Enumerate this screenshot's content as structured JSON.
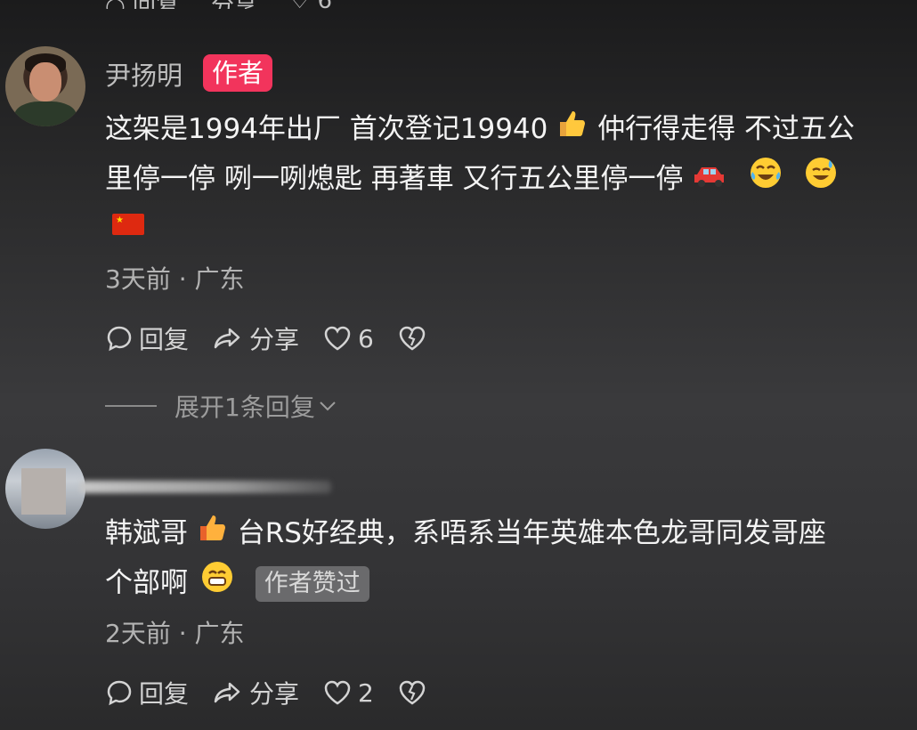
{
  "comments": [
    {
      "username": "尹扬明",
      "badge": "作者",
      "text_line1": "这架是1994年出厂 首次登记19940",
      "text_line1b": "仲行得走得 不过五公",
      "text_line2": "里停一停 咧一咧熄匙 再著車 又行五公里停一停",
      "meta": "3天前 · 广东",
      "reply_label": "回复",
      "share_label": "分享",
      "like_count": "6",
      "expand_label": "展开1条回复",
      "emojis": [
        "thumbs-up",
        "car",
        "tears-of-joy",
        "sweat-smile",
        "china-flag"
      ]
    },
    {
      "username": "",
      "text_line1a": "韩斌哥",
      "text_line1b": "台RS好经典，系唔系当年英雄本色龙哥同发哥座",
      "text_line2": "个部啊",
      "liked_by_author": "作者赞过",
      "meta": "2天前 · 广东",
      "reply_label": "回复",
      "share_label": "分享",
      "like_count": "2",
      "emojis": [
        "thumbs-up",
        "grin"
      ]
    }
  ],
  "colors": {
    "author_badge": "#f2345c",
    "background_top": "#1b1b1c",
    "background_mid": "#3a3a3c"
  }
}
